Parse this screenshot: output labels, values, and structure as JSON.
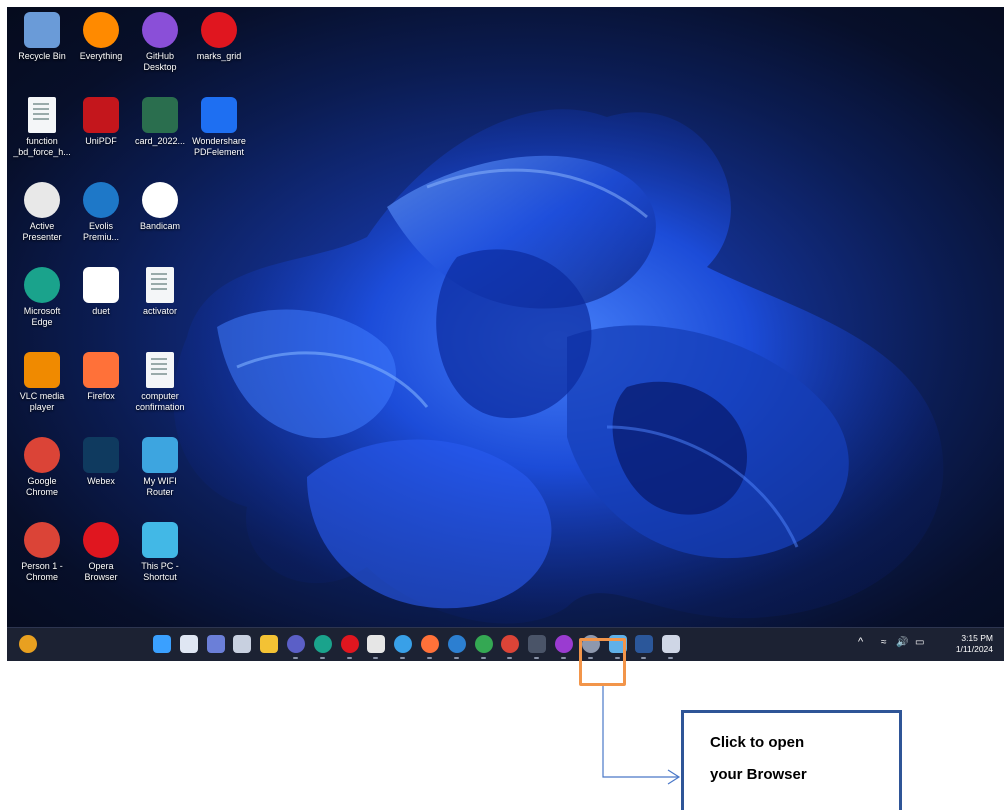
{
  "desktop": {
    "columns": [
      [
        {
          "label": "Recycle Bin",
          "icon": "recycle-bin-icon",
          "color": "#6a9bd8"
        },
        {
          "label": "function _bd_force_h...",
          "icon": "document-icon",
          "color": "#f4f6f8"
        },
        {
          "label": "Active Presenter",
          "icon": "active-presenter-icon",
          "color": "#e8e8e8"
        },
        {
          "label": "Microsoft Edge",
          "icon": "edge-icon",
          "color": "#1aa38c"
        },
        {
          "label": "VLC media player",
          "icon": "vlc-icon",
          "color": "#f08a00"
        },
        {
          "label": "Google Chrome",
          "icon": "chrome-icon",
          "color": "#db4437"
        },
        {
          "label": "Person 1 - Chrome",
          "icon": "chrome-profile-icon",
          "color": "#db4437"
        }
      ],
      [
        {
          "label": "Everything",
          "icon": "everything-search-icon",
          "color": "#ff8a00"
        },
        {
          "label": "UniPDF",
          "icon": "unipdf-icon",
          "color": "#c4161c"
        },
        {
          "label": "Evolis Premiu...",
          "icon": "evolis-icon",
          "color": "#1e78c8"
        },
        {
          "label": "duet",
          "icon": "duet-icon",
          "color": "#ffffff"
        },
        {
          "label": "Firefox",
          "icon": "firefox-icon",
          "color": "#ff7139"
        },
        {
          "label": "Webex",
          "icon": "webex-icon",
          "color": "#0f3a5f"
        },
        {
          "label": "Opera Browser",
          "icon": "opera-icon",
          "color": "#e0161f"
        }
      ],
      [
        {
          "label": "GitHub Desktop",
          "icon": "github-desktop-icon",
          "color": "#8a4fd8"
        },
        {
          "label": "card_2022...",
          "icon": "image-file-icon",
          "color": "#2a6e4e"
        },
        {
          "label": "Bandicam",
          "icon": "bandicam-icon",
          "color": "#ffffff"
        },
        {
          "label": "activator",
          "icon": "document-icon",
          "color": "#f4f6f8"
        },
        {
          "label": "computer confirmation",
          "icon": "word-document-icon",
          "color": "#f4f6f8"
        },
        {
          "label": "My WIFI Router",
          "icon": "wifi-router-icon",
          "color": "#3da5e0"
        },
        {
          "label": "This PC - Shortcut",
          "icon": "monitor-icon",
          "color": "#42b8e6"
        }
      ],
      [
        {
          "label": "marks_grid",
          "icon": "opera-icon",
          "color": "#e0161f"
        },
        {
          "label": "Wondershare PDFelement",
          "icon": "pdfelement-icon",
          "color": "#1e6ff2"
        }
      ]
    ]
  },
  "taskbar": {
    "items": [
      {
        "name": "start-icon",
        "color": "#3aa0ff"
      },
      {
        "name": "search-icon",
        "color": "#dfe6f3"
      },
      {
        "name": "teams-chat-icon",
        "color": "#6b7fd8"
      },
      {
        "name": "task-view-icon",
        "color": "#c8d0e0"
      },
      {
        "name": "file-explorer-icon",
        "color": "#f3c234"
      },
      {
        "name": "teams-icon",
        "color": "#5b5fc7"
      },
      {
        "name": "edge-icon",
        "color": "#1aa38c"
      },
      {
        "name": "opera-icon",
        "color": "#e0161f"
      },
      {
        "name": "store-icon",
        "color": "#e6e6e6"
      },
      {
        "name": "chrome-colorful-icon",
        "color": "#38a0e8"
      },
      {
        "name": "firefox-icon",
        "color": "#ff7139"
      },
      {
        "name": "webex-icon",
        "color": "#2c7fd1"
      },
      {
        "name": "chrome-icon",
        "color": "#34a853"
      },
      {
        "name": "chrome-icon",
        "color": "#db4437"
      },
      {
        "name": "terminal-icon",
        "color": "#4a5468"
      },
      {
        "name": "chrome-profile-icon",
        "color": "#9a3bd1"
      },
      {
        "name": "settings-icon",
        "color": "#8e98ad"
      },
      {
        "name": "notepad-icon",
        "color": "#5fb0e8"
      },
      {
        "name": "word-icon",
        "color": "#2b579a"
      },
      {
        "name": "snipping-tool-icon",
        "color": "#cfd6e6"
      }
    ],
    "tray": {
      "chevron": "^",
      "wifi": "≈",
      "volume": "🔊",
      "battery": "▭"
    },
    "clock": {
      "time": "3:15 PM",
      "date": "1/11/2024"
    }
  },
  "annotation": {
    "line1": "Click to open",
    "line2": "your Browser",
    "highlight_color": "#f2954a",
    "box_color": "#2f5597"
  }
}
